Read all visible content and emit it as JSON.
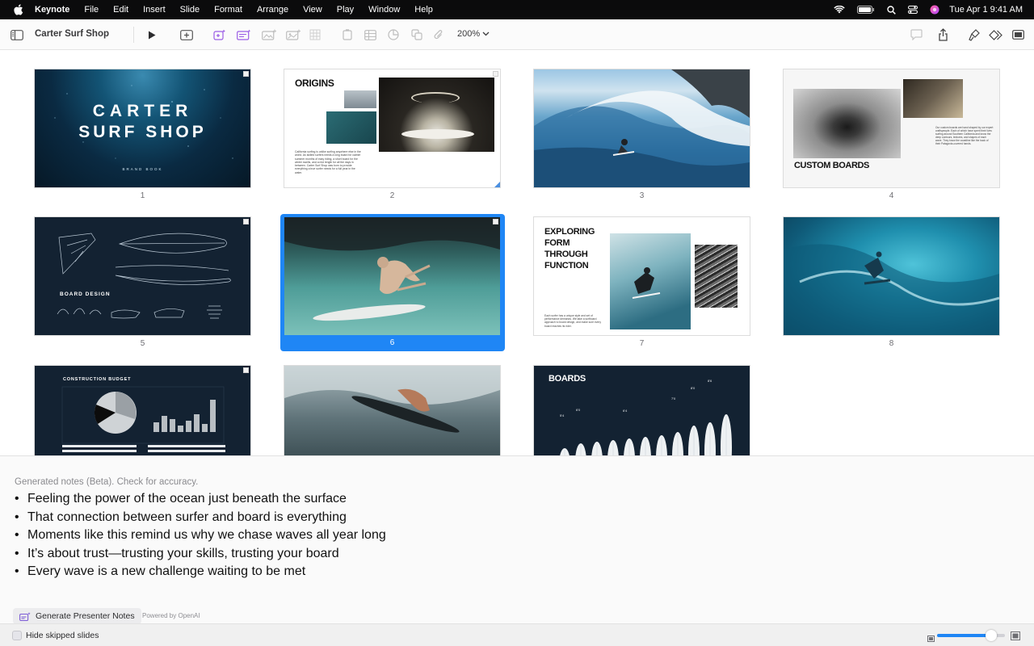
{
  "menubar": {
    "app": "Keynote",
    "items": [
      "File",
      "Edit",
      "Insert",
      "Slide",
      "Format",
      "Arrange",
      "View",
      "Play",
      "Window",
      "Help"
    ],
    "clock": "Tue Apr 1  9:41 AM"
  },
  "toolbar": {
    "doc_title": "Carter Surf Shop",
    "zoom": "200%"
  },
  "slides": {
    "numbers": [
      "1",
      "2",
      "3",
      "4",
      "5",
      "6",
      "7",
      "8"
    ],
    "selected_index": 6,
    "s1": {
      "line1": "CARTER",
      "line2": "SURF SHOP",
      "sub": "BRAND BOOK"
    },
    "s2": {
      "title": "ORIGINS",
      "body": "California surfing is unlike surfing anywhere else in the world. As skilled surfers needs a long board for calmer summer months of easy riding, a short board for the winter swells, and a mid length for all the days in between. Carter Surf Shop was born to provide everything a true surfer needs for a full year in the water."
    },
    "s4": {
      "title": "CUSTOM BOARDS",
      "body": "Our custom boards are hand shaped by our expert craftspeople. Each of which have spent their lives surfing around Southern California and know the deep contours, textures, and shapes of each wave. They know the coastline like the back of their Patagonia-covered hands."
    },
    "s5": {
      "title": "BOARD DESIGN"
    },
    "s7": {
      "title_l1": "EXPLORING",
      "title_l2": "FORM",
      "title_l3": "THROUGH",
      "title_l4": "FUNCTION",
      "body": "Each surfer has a unique style and set of performance demands. We take a surfboard approach to board design, and make sure every board reaches its rider."
    },
    "s9": {
      "title": "CONSTRUCTION BUDGET"
    },
    "s11": {
      "title": "BOARDS",
      "sizes": [
        "5'4",
        "6'0",
        "6'4",
        "7'0",
        "8'0",
        "8'6"
      ]
    }
  },
  "notes": {
    "hint": "Generated notes (Beta). Check for accuracy.",
    "bullets": [
      "Feeling the power of the ocean just beneath the surface",
      "That connection between surfer and board is everything",
      "Moments like this remind us why we chase waves all year long",
      "It’s about trust—trusting your skills, trusting your board",
      "Every wave is a new challenge waiting to be met"
    ],
    "generate_label": "Generate Presenter Notes",
    "powered": "Powered by OpenAI"
  },
  "status": {
    "hide_skipped_label": "Hide skipped slides",
    "zoom_fraction": 0.8
  },
  "colors": {
    "accent": "#1f86f5",
    "menubar": "#0b0b0c",
    "dark_slide": "#13202c"
  }
}
